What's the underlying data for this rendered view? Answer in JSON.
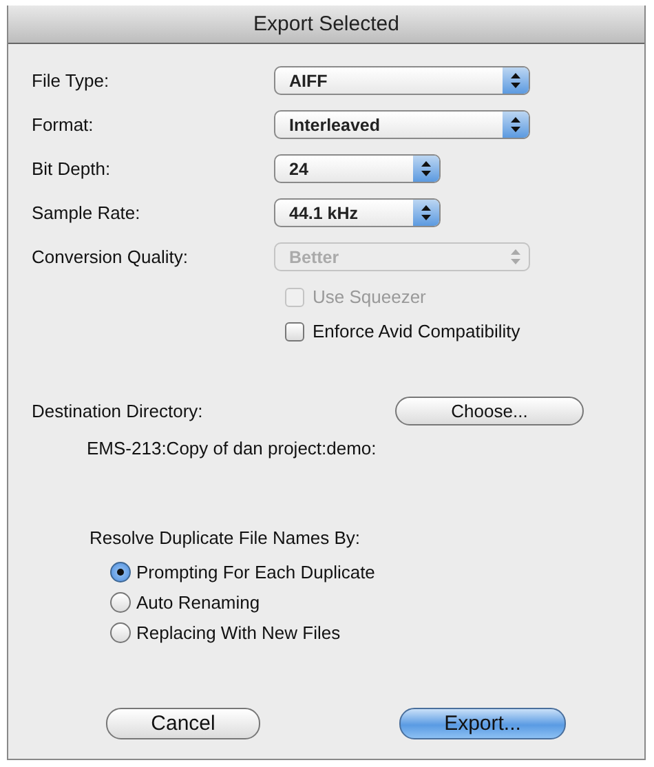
{
  "window": {
    "title": "Export Selected"
  },
  "popups": [
    {
      "label": "File Type:",
      "value": "AIFF",
      "kind": "wide",
      "disabled": false
    },
    {
      "label": "Format:",
      "value": "Interleaved",
      "kind": "wide",
      "disabled": false
    },
    {
      "label": "Bit Depth:",
      "value": "24",
      "kind": "narrow",
      "disabled": false
    },
    {
      "label": "Sample Rate:",
      "value": "44.1 kHz",
      "kind": "narrow",
      "disabled": false
    },
    {
      "label": "Conversion Quality:",
      "value": "Better",
      "kind": "wide",
      "disabled": true
    }
  ],
  "checkboxes": [
    {
      "label": "Use Squeezer",
      "checked": false,
      "disabled": true
    },
    {
      "label": "Enforce Avid Compatibility",
      "checked": false,
      "disabled": false
    }
  ],
  "destination": {
    "label": "Destination Directory:",
    "button": "Choose...",
    "path": "EMS-213:Copy of dan project:demo:"
  },
  "duplicates": {
    "label": "Resolve Duplicate File Names By:",
    "options": [
      {
        "label": "Prompting For Each Duplicate",
        "selected": true
      },
      {
        "label": "Auto Renaming",
        "selected": false
      },
      {
        "label": "Replacing With New Files",
        "selected": false
      }
    ]
  },
  "buttons": [
    {
      "label": "Cancel",
      "default": false
    },
    {
      "label": "Export...",
      "default": true
    }
  ]
}
